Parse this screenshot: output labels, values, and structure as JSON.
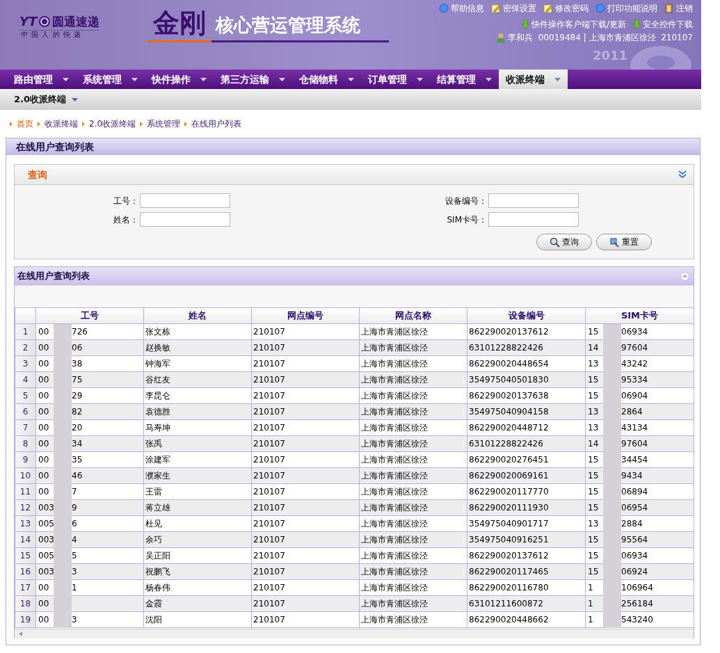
{
  "header": {
    "logo": {
      "mark": "YT",
      "brand": "圆通速递",
      "slogan": "中 国 人 的 快 递"
    },
    "system_title": "金刚",
    "system_subtitle": "核心营运管理系统",
    "year": "2011",
    "top_links": [
      {
        "label": "帮助信息"
      },
      {
        "label": "密保设置"
      },
      {
        "label": "修改密码"
      },
      {
        "label": "打印功能说明"
      },
      {
        "label": "注销"
      }
    ],
    "downloads": [
      {
        "label": "快件操作客户端下载/更新"
      },
      {
        "label": "安全控件下载"
      }
    ],
    "user": "李和兵  00019484 | 上海市青浦区徐泾  210107"
  },
  "nav": {
    "items": [
      {
        "label": "路由管理",
        "selected": false
      },
      {
        "label": "系统管理",
        "selected": false
      },
      {
        "label": "快件操作",
        "selected": false
      },
      {
        "label": "第三方运输",
        "selected": false
      },
      {
        "label": "仓储物料",
        "selected": false
      },
      {
        "label": "订单管理",
        "selected": false
      },
      {
        "label": "结算管理",
        "selected": false
      },
      {
        "label": "收派终端",
        "selected": true
      }
    ]
  },
  "subnav": {
    "items": [
      {
        "label": "2.0收派终端"
      }
    ]
  },
  "breadcrumb": [
    {
      "label": "首页",
      "kind": "home"
    },
    {
      "label": "收派终端",
      "kind": "link"
    },
    {
      "label": "2.0收派终端",
      "kind": "link"
    },
    {
      "label": "系统管理",
      "kind": "link"
    },
    {
      "label": "在线用户列表",
      "kind": "link"
    }
  ],
  "page_title": "在线用户查询列表",
  "query": {
    "title": "查询",
    "fields": [
      {
        "label": "工号："
      },
      {
        "label": "设备编号："
      },
      {
        "label": "姓名："
      },
      {
        "label": "SIM卡号："
      }
    ],
    "buttons": [
      {
        "label": "查询"
      },
      {
        "label": "重置"
      }
    ]
  },
  "grid": {
    "title": "在线用户查询列表",
    "columns": [
      "工号",
      "姓名",
      "网点编号",
      "网点名称",
      "设备编号",
      "SIM卡号"
    ],
    "rows": [
      {
        "number": "1",
        "id_start": "00",
        "id_end": "726",
        "name": "张文栋",
        "site_code": "210107",
        "site_name": "上海市青浦区徐泾",
        "device": "862290020137612",
        "sim_start": "15",
        "sim_end": "06934"
      },
      {
        "number": "2",
        "id_start": "00",
        "id_end": "06",
        "name": "赵换敏",
        "site_code": "210107",
        "site_name": "上海市青浦区徐泾",
        "device": "63101228822426",
        "sim_start": "14",
        "sim_end": "97604"
      },
      {
        "number": "3",
        "id_start": "00",
        "id_end": "38",
        "name": "钟海军",
        "site_code": "210107",
        "site_name": "上海市青浦区徐泾",
        "device": "862290020448654",
        "sim_start": "13",
        "sim_end": "43242"
      },
      {
        "number": "4",
        "id_start": "00",
        "id_end": "75",
        "name": "谷红友",
        "site_code": "210107",
        "site_name": "上海市青浦区徐泾",
        "device": "354975040501830",
        "sim_start": "15",
        "sim_end": "95334"
      },
      {
        "number": "5",
        "id_start": "00",
        "id_end": "29",
        "name": "李昆仑",
        "site_code": "210107",
        "site_name": "上海市青浦区徐泾",
        "device": "862290020137638",
        "sim_start": "15",
        "sim_end": "06904"
      },
      {
        "number": "6",
        "id_start": "00",
        "id_end": "82",
        "name": "袁德胜",
        "site_code": "210107",
        "site_name": "上海市青浦区徐泾",
        "device": "354975040904158",
        "sim_start": "13",
        "sim_end": "2864"
      },
      {
        "number": "7",
        "id_start": "00",
        "id_end": "20",
        "name": "马寿坤",
        "site_code": "210107",
        "site_name": "上海市青浦区徐泾",
        "device": "862290020448712",
        "sim_start": "13",
        "sim_end": "43134"
      },
      {
        "number": "8",
        "id_start": "00",
        "id_end": "34",
        "name": "张禹",
        "site_code": "210107",
        "site_name": "上海市青浦区徐泾",
        "device": "63101228822426",
        "sim_start": "14",
        "sim_end": "97604"
      },
      {
        "number": "9",
        "id_start": "00",
        "id_end": "35",
        "name": "涂建军",
        "site_code": "210107",
        "site_name": "上海市青浦区徐泾",
        "device": "862290020276451",
        "sim_start": "15",
        "sim_end": "34454"
      },
      {
        "number": "10",
        "id_start": "00",
        "id_end": "46",
        "name": "濮家生",
        "site_code": "210107",
        "site_name": "上海市青浦区徐泾",
        "device": "862290020069161",
        "sim_start": "15",
        "sim_end": "9434"
      },
      {
        "number": "11",
        "id_start": "00",
        "id_end": "7",
        "name": "王雷",
        "site_code": "210107",
        "site_name": "上海市青浦区徐泾",
        "device": "862290020117770",
        "sim_start": "15",
        "sim_end": "06894"
      },
      {
        "number": "12",
        "id_start": "003",
        "id_end": "9",
        "name": "蒋立雄",
        "site_code": "210107",
        "site_name": "上海市青浦区徐泾",
        "device": "862290020111930",
        "sim_start": "15",
        "sim_end": "06954"
      },
      {
        "number": "13",
        "id_start": "005",
        "id_end": "6",
        "name": "杜见",
        "site_code": "210107",
        "site_name": "上海市青浦区徐泾",
        "device": "354975040901717",
        "sim_start": "13",
        "sim_end": "2884"
      },
      {
        "number": "14",
        "id_start": "003",
        "id_end": "4",
        "name": "余巧",
        "site_code": "210107",
        "site_name": "上海市青浦区徐泾",
        "device": "354975040916251",
        "sim_start": "15",
        "sim_end": "95564"
      },
      {
        "number": "15",
        "id_start": "005",
        "id_end": "5",
        "name": "吴正阳",
        "site_code": "210107",
        "site_name": "上海市青浦区徐泾",
        "device": "862290020137612",
        "sim_start": "15",
        "sim_end": "06934"
      },
      {
        "number": "16",
        "id_start": "003",
        "id_end": "3",
        "name": "祝鹏飞",
        "site_code": "210107",
        "site_name": "上海市青浦区徐泾",
        "device": "862290020117465",
        "sim_start": "15",
        "sim_end": "06924"
      },
      {
        "number": "17",
        "id_start": "00",
        "id_end": "1",
        "name": "杨春伟",
        "site_code": "210107",
        "site_name": "上海市青浦区徐泾",
        "device": "862290020116780",
        "sim_start": "1",
        "sim_end": "106964"
      },
      {
        "number": "18",
        "id_start": "00",
        "id_end": "",
        "name": "金霞",
        "site_code": "210107",
        "site_name": "上海市青浦区徐泾",
        "device": "63101211600872",
        "sim_start": "1",
        "sim_end": "256184"
      },
      {
        "number": "19",
        "id_start": "00",
        "id_end": "3",
        "name": "沈阳",
        "site_code": "210107",
        "site_name": "上海市青浦区徐泾",
        "device": "862290020448662",
        "sim_start": "1",
        "sim_end": "543240"
      }
    ]
  }
}
